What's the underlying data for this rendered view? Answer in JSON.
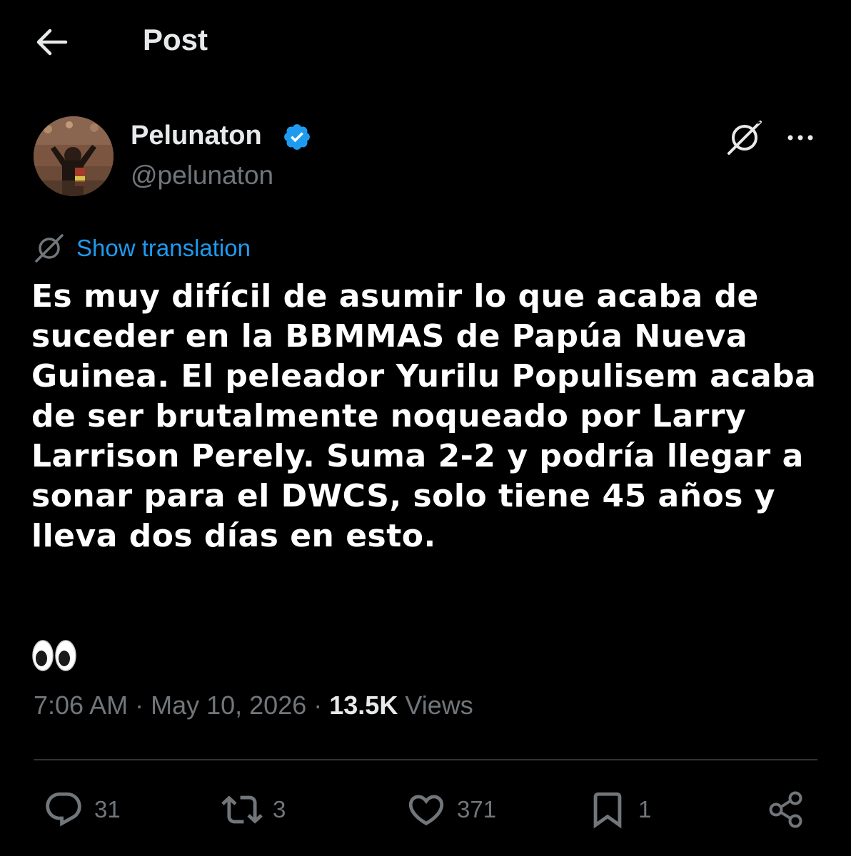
{
  "header": {
    "title": "Post",
    "back_icon": "arrow-left-icon"
  },
  "author": {
    "display_name": "Pelunaton",
    "handle": "@pelunaton",
    "verified": true,
    "verified_color": "#1d9bf0"
  },
  "translation": {
    "label": "Show translation",
    "icon": "grok-icon"
  },
  "post": {
    "text": "Es muy difícil de asumir lo que acaba de suceder en la BBMMAS de Papúa Nueva Guinea. El peleador Yurilu Populisem acaba de ser brutalmente noqueado por Larry Larrison Perely. Suma 2-2 y podría llegar a sonar para el DWCS, solo tiene 45 años y lleva dos días en esto.",
    "emoji": "eyes-emoji"
  },
  "meta": {
    "time": "7:06 AM",
    "separator": " · ",
    "date": "May 10, 2026",
    "views_count": "13.5K",
    "views_label": "Views"
  },
  "actions": {
    "replies": "31",
    "reposts": "3",
    "likes": "371",
    "bookmarks": "1"
  },
  "colors": {
    "background": "#000000",
    "text": "#e7e9ea",
    "secondary": "#71767b",
    "accent": "#1d9bf0",
    "divider": "#2f3336"
  }
}
